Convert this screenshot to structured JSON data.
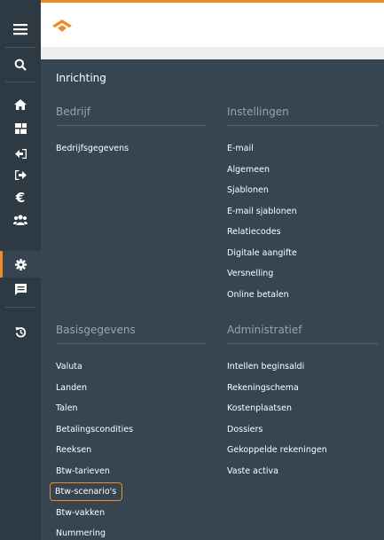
{
  "rail": {
    "menu_icon": "hamburger-icon",
    "items": [
      {
        "icon": "search-icon",
        "glyph": "⌕"
      },
      {
        "icon": "home-icon",
        "glyph": "⌂"
      },
      {
        "icon": "dashboard-icon",
        "glyph": "▦"
      },
      {
        "icon": "sign-in-icon",
        "glyph": "⇤"
      },
      {
        "icon": "sign-out-icon",
        "glyph": "⇥"
      },
      {
        "icon": "euro-icon",
        "glyph": "€"
      },
      {
        "icon": "users-icon",
        "glyph": "👥"
      },
      {
        "icon": "gear-icon",
        "glyph": "⚙"
      },
      {
        "icon": "chat-icon",
        "glyph": "▤"
      },
      {
        "icon": "history-icon",
        "glyph": "↺"
      }
    ],
    "active": "gear-icon"
  },
  "panel": {
    "title": "Inrichting",
    "bedrijf": {
      "heading": "Bedrijf",
      "items": [
        "Bedrijfsgegevens"
      ]
    },
    "instellingen": {
      "heading": "Instellingen",
      "items": [
        "E-mail",
        "Algemeen",
        "Sjablonen",
        "E-mail sjablonen",
        "Relatiecodes",
        "Digitale aangifte",
        "Versnelling",
        "Online betalen"
      ]
    },
    "basisgegevens": {
      "heading": "Basisgegevens",
      "items": [
        "Valuta",
        "Landen",
        "Talen",
        "Betalingscondities",
        "Reeksen",
        "Btw-tarieven",
        "Btw-scenario's",
        "Btw-vakken",
        "Nummering"
      ]
    },
    "administratief": {
      "heading": "Administratief",
      "items": [
        "Intellen beginsaldi",
        "Rekeningschema",
        "Kostenplaatsen",
        "Dossiers",
        "Gekoppelde rekeningen",
        "Vaste activa"
      ]
    }
  },
  "colors": {
    "rail": "#2d3a43",
    "panel": "#36454f",
    "accent": "#f08a24"
  }
}
